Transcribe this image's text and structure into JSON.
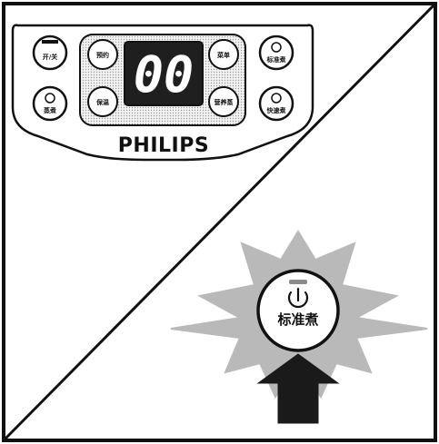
{
  "panel": {
    "brand": "PHILIPS",
    "display": "00",
    "left_top_label": "开/关",
    "left_bottom_label": "蒸煮",
    "inner_left_top_label": "预约",
    "inner_left_bottom_label": "保温",
    "inner_right_top_label": "菜单",
    "inner_right_bottom_label": "营养蒸",
    "right_top_label": "标准煮",
    "right_bottom_label": "快速煮"
  },
  "highlight": {
    "button_label": "标准煮",
    "icon": "power-icon"
  },
  "colors": {
    "ink": "#111111",
    "burst": "#b9b9b9",
    "arrow": "#1a1a1a",
    "display_bg": "#1f1f1f"
  }
}
